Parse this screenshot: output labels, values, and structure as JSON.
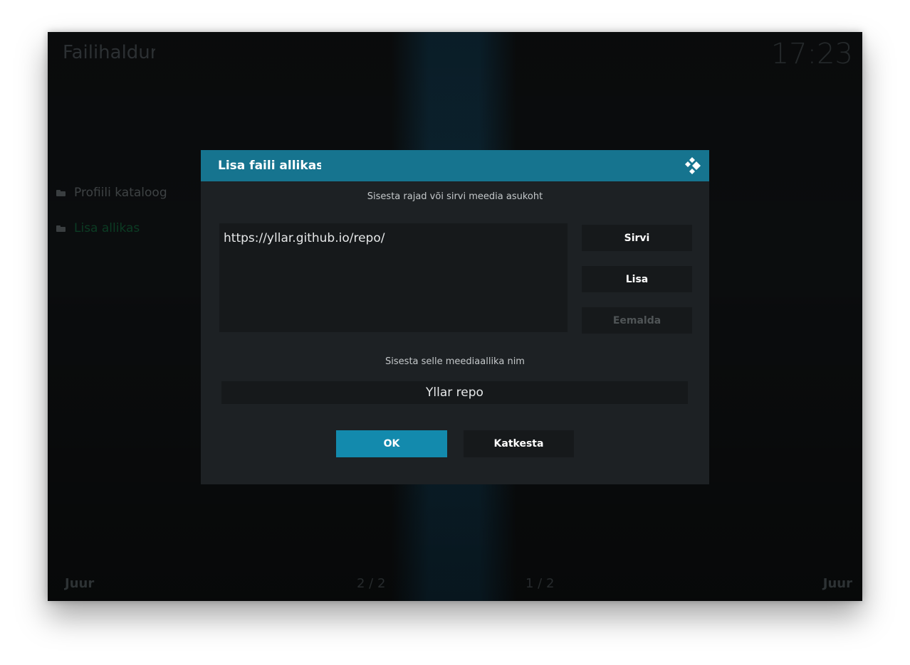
{
  "app": {
    "title": "Failihaldur",
    "clock": "17:23"
  },
  "sidebar": {
    "items": [
      {
        "label": "Profiili kataloog",
        "icon": "folder-icon"
      },
      {
        "label": "Lisa allikas",
        "icon": "folder-icon"
      }
    ]
  },
  "footer": {
    "left_label": "Juur",
    "right_label": "Juur",
    "left_page": "2 / 2",
    "right_page": "1 / 2"
  },
  "dialog": {
    "title": "Lisa faili allikas",
    "path_prompt": "Sisesta rajad või sirvi meedia asukoht",
    "paths": [
      "https://yllar.github.io/repo/"
    ],
    "browse_label": "Sirvi",
    "add_label": "Lisa",
    "remove_label": "Eemalda",
    "name_prompt": "Sisesta selle meediaallika nim",
    "name_value": "Yllar repo",
    "ok_label": "OK",
    "cancel_label": "Katkesta",
    "accent": "#16748f",
    "ok_color": "#138aad"
  }
}
